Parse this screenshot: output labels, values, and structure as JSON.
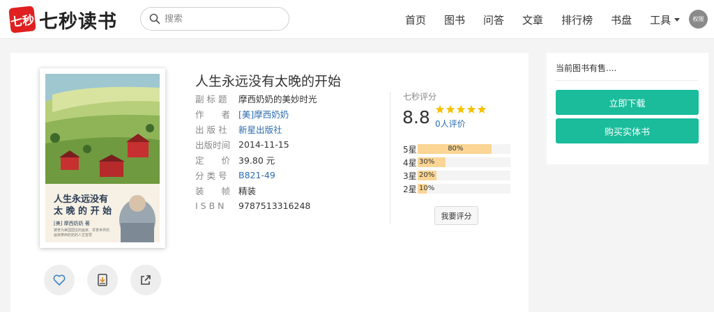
{
  "header": {
    "logo_mark": "七秒",
    "logo_text": "七秒读书",
    "search": {
      "placeholder": "搜索"
    },
    "nav": [
      "首页",
      "图书",
      "问答",
      "文章",
      "排行榜",
      "书盘",
      "工具"
    ],
    "avatar_label": "权限"
  },
  "book": {
    "title": "人生永远没有太晚的开始",
    "cover": {
      "title_line1": "人生永远没有",
      "title_line2": "太 晚 的 开 始",
      "author": "[美] 摩西奶奶 著",
      "blurb": "被誉为美国国宝的画家、享誉世界的画家摩西奶奶的人生智慧"
    },
    "info": [
      {
        "label": "副 标 题",
        "value": "摩西奶奶的美妙时光",
        "link": false
      },
      {
        "label": "作　　者",
        "value": "[美]摩西奶奶",
        "link": true
      },
      {
        "label": "出 版 社",
        "value": "新星出版社",
        "link": true
      },
      {
        "label": "出版时间",
        "value": "2014-11-15",
        "link": false
      },
      {
        "label": "定　　价",
        "value": "39.80 元",
        "link": false
      },
      {
        "label": "分 类 号",
        "value": "B821-49",
        "link": true
      },
      {
        "label": "装　　帧",
        "value": "精装",
        "link": false
      },
      {
        "label": "I S B N",
        "value": "9787513316248",
        "link": false
      }
    ]
  },
  "rating": {
    "label": "七秒评分",
    "score": "8.8",
    "stars": 5,
    "reviews": "0人评价",
    "rate_button": "我要评分",
    "distribution": [
      {
        "label": "5星",
        "percent": 80,
        "text": "80%"
      },
      {
        "label": "4星",
        "percent": 30,
        "text": "30%"
      },
      {
        "label": "3星",
        "percent": 20,
        "text": "20%"
      },
      {
        "label": "2星",
        "percent": 10,
        "text": "10%"
      }
    ]
  },
  "sidebar": {
    "sale_text": "当前图书有售....",
    "download_button": "立即下载",
    "buy_button": "购买实体书"
  },
  "colors": {
    "accent": "#1abc9c",
    "link": "#2b6cb0",
    "star": "#f7c100",
    "bar_fill": "#fbd594",
    "logo": "#e02020"
  },
  "icons": [
    "search-icon",
    "heart-icon",
    "book-download-icon",
    "share-icon",
    "caret-down-icon",
    "star-icon"
  ]
}
